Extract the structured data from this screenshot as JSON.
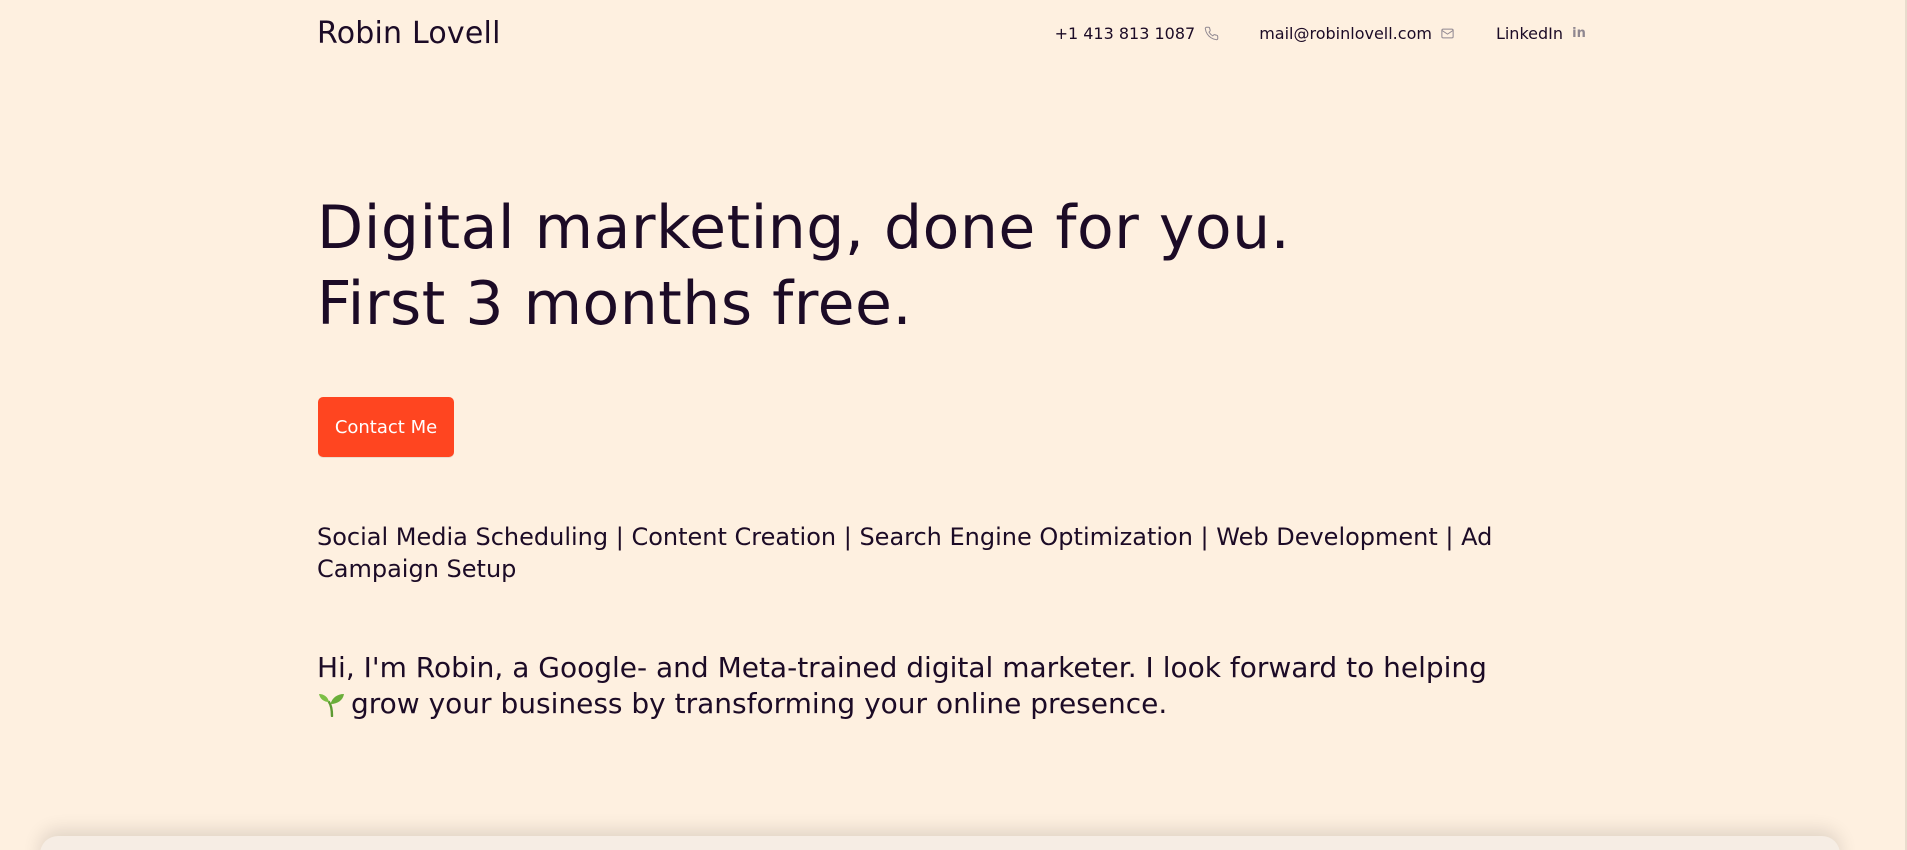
{
  "header": {
    "brand": "Robin Lovell",
    "phone": {
      "label": "+1 413 813 1087",
      "icon": "phone-icon"
    },
    "email": {
      "label": "mail@robinlovell.com",
      "icon": "mail-icon"
    },
    "linkedin": {
      "label": "LinkedIn",
      "icon": "linkedin-icon",
      "icon_text": "in"
    }
  },
  "hero": {
    "headline_line1": "Digital marketing, done for you.",
    "headline_line2": "First 3 months free.",
    "cta_label": "Contact Me",
    "services": "Social Media Scheduling | Content Creation | Search Engine Optimization | Web Development | Ad Campaign Setup",
    "intro_before": "Hi, I'm Robin, a Google- and Meta-trained digital marketer. I look forward to helping",
    "intro_after": "grow your business by transforming your online presence.",
    "intro_icon": "sprout-icon"
  },
  "colors": {
    "background": "#fef0e0",
    "text": "#1c0b26",
    "accent": "#ff4520",
    "icon_muted": "#8f8790"
  }
}
